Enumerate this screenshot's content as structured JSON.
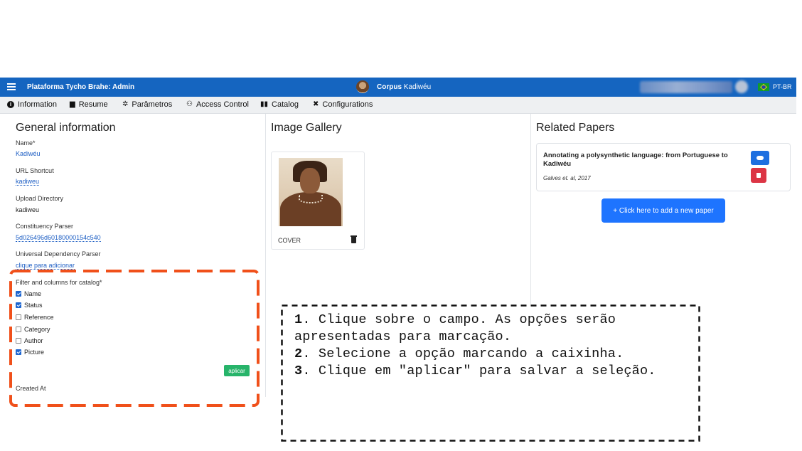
{
  "navbar": {
    "app_title": "Plataforma Tycho Brahe: Admin",
    "corpus_prefix": "Corpus",
    "corpus_name": "Kadiwéu",
    "language": "PT-BR",
    "color": "#1565c0"
  },
  "tabs": [
    {
      "label": "Information",
      "icon": "info-icon"
    },
    {
      "label": "Resume",
      "icon": "file-icon"
    },
    {
      "label": "Parâmetros",
      "icon": "gears-icon"
    },
    {
      "label": "Access Control",
      "icon": "users-icon"
    },
    {
      "label": "Catalog",
      "icon": "book-icon"
    },
    {
      "label": "Configurations",
      "icon": "tools-icon"
    }
  ],
  "general": {
    "heading": "General information",
    "name_label": "Name*",
    "name_value": "Kadiwéu",
    "url_label": "URL Shortcut",
    "url_value": "kadiweu",
    "upload_label": "Upload Directory",
    "upload_value": "kadiweu",
    "parser_label": "Constituency Parser",
    "parser_value": "5d026496d60180000154c540",
    "ud_label": "Universal Dependency Parser",
    "ud_value": "clique para adicionar",
    "filter_label": "Filter and columns for catalog*",
    "options": [
      {
        "label": "Name",
        "checked": true
      },
      {
        "label": "Status",
        "checked": true
      },
      {
        "label": "Reference",
        "checked": false
      },
      {
        "label": "Category",
        "checked": false
      },
      {
        "label": "Author",
        "checked": false
      },
      {
        "label": "Picture",
        "checked": true
      }
    ],
    "apply_label": "aplicar",
    "created_label": "Created At"
  },
  "gallery": {
    "heading": "Image Gallery",
    "cover_label": "COVER"
  },
  "papers": {
    "heading": "Related Papers",
    "items": [
      {
        "title": "Annotating a polysynthetic language: from Portuguese to Kadiwéu",
        "authors": "Galves et. al, 2017"
      }
    ],
    "add_label": "+ Click here to add a new paper"
  },
  "callout": {
    "step1_num": "1",
    "step1_text": ". Clique sobre o campo. As opções serão apresentadas para marcação.",
    "step2_num": "2",
    "step2_text": ". Selecione a opção marcando a caixinha.",
    "step3_num": "3",
    "step3_text": ". Clique em \"aplicar\" para salvar a seleção."
  },
  "colors": {
    "highlight_orange": "#f0501a",
    "apply_green": "#27b46a",
    "primary_blue": "#1e74ff",
    "danger_red": "#dc3545"
  }
}
